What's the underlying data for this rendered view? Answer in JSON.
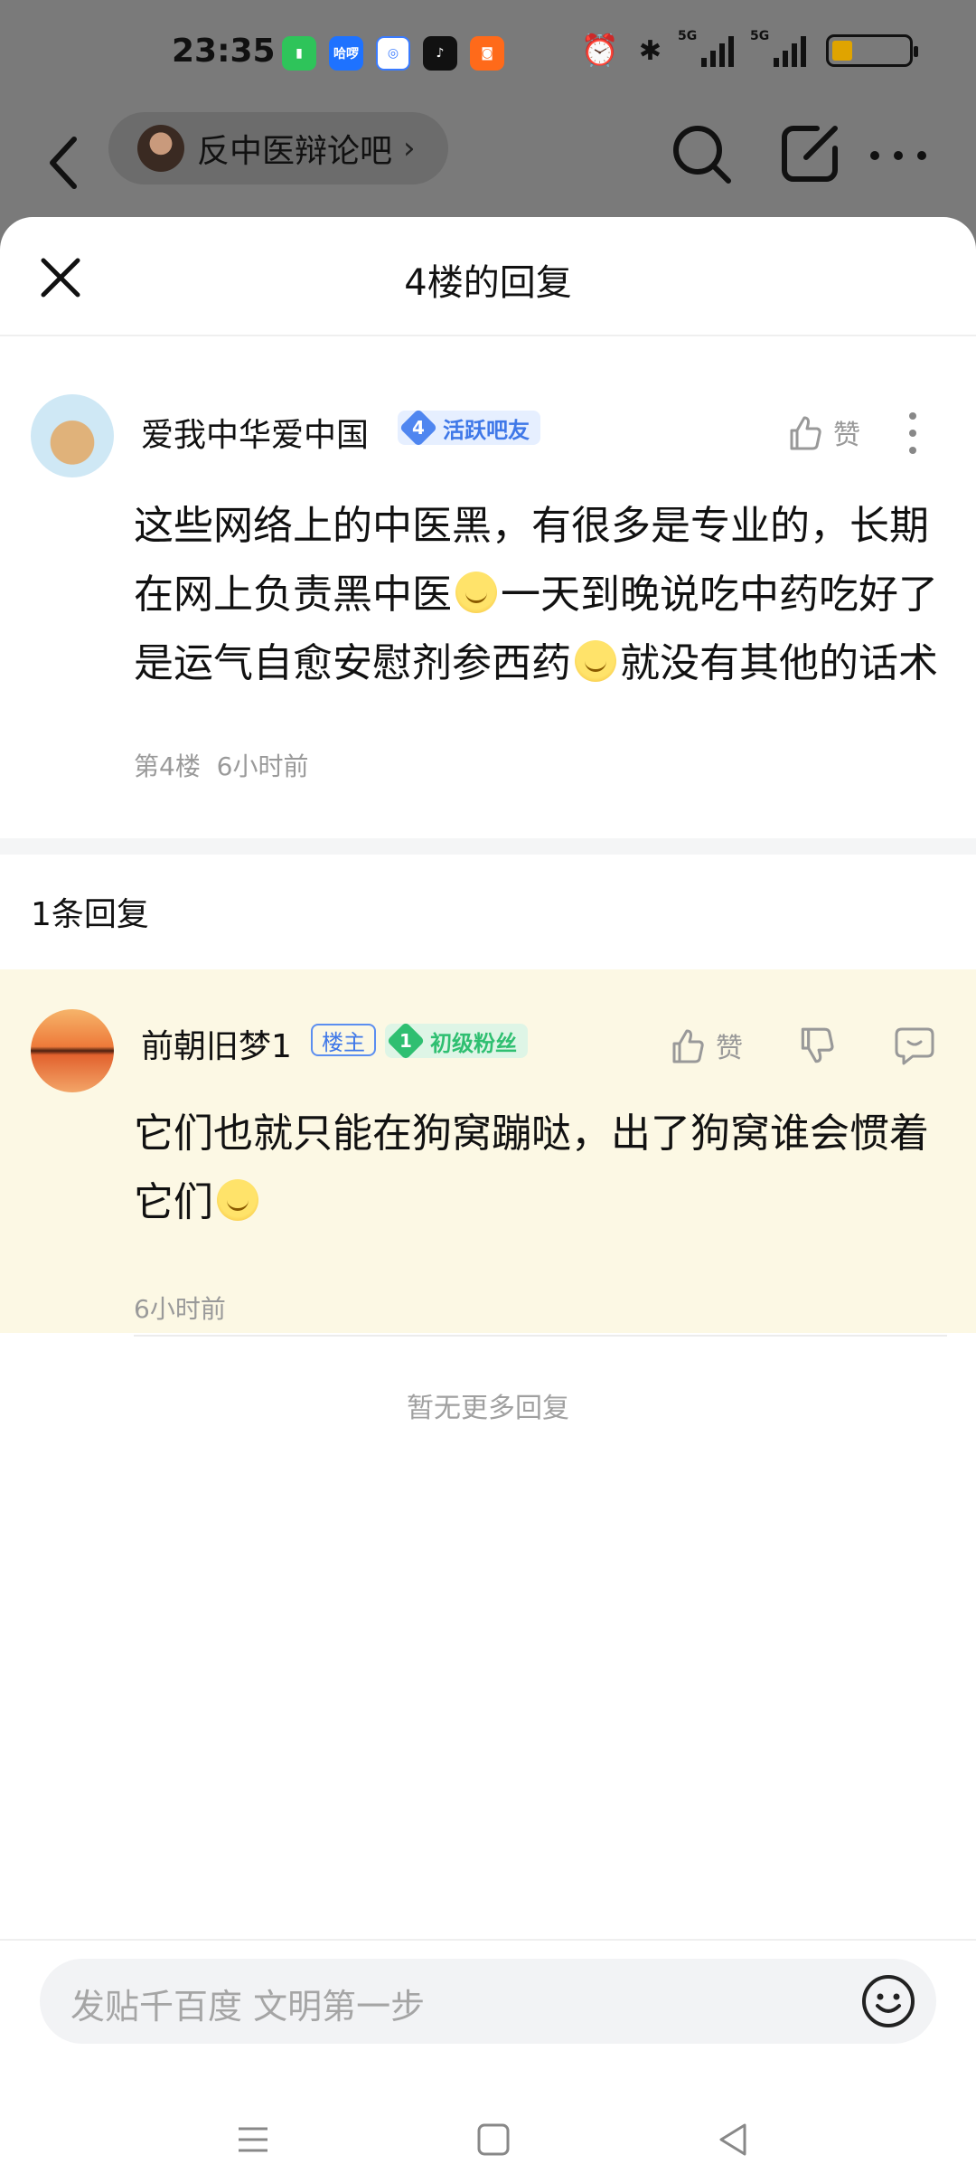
{
  "status_bar": {
    "time": "23:35",
    "apps": [
      "battery-app-icon",
      "haxi-app-icon",
      "browser-app-icon",
      "tiktok-app-icon",
      "reader-app-icon"
    ],
    "app_label_haxi": "哈啰",
    "signal_1": "5G",
    "signal_2": "5G"
  },
  "header": {
    "forum_name": "反中医辩论吧",
    "icons": [
      "back-icon",
      "search-icon",
      "edit-icon",
      "more-icon"
    ]
  },
  "sheet": {
    "title": "4楼的回复"
  },
  "post": {
    "username": "爱我中华爱中国",
    "level_num": "4",
    "level_title": "活跃吧友",
    "like_label": "赞",
    "content_1": "这些网络上的中医黑，有很多是专业的，长期在网上负责黑中医",
    "content_2": "一天到晚说吃中药吃好了是运气自愈安慰剂参西药",
    "content_3": "就没有其他的话术",
    "floor": "第4楼",
    "time": "6小时前"
  },
  "replies_count_label": "1条回复",
  "reply": {
    "username": "前朝旧梦1",
    "owner_tag": "楼主",
    "level_num": "1",
    "level_title": "初级粉丝",
    "like_label": "赞",
    "content": "它们也就只能在狗窝蹦哒，出了狗窝谁会惯着它们",
    "time": "6小时前"
  },
  "no_more_label": "暂无更多回复",
  "input": {
    "placeholder": "发贴千百度 文明第一步"
  },
  "colors": {
    "accent_blue": "#3f78e8",
    "level4_bg": "#e6efff",
    "level1_green": "#2fbf71",
    "reply_bg": "#fcf8e4"
  }
}
